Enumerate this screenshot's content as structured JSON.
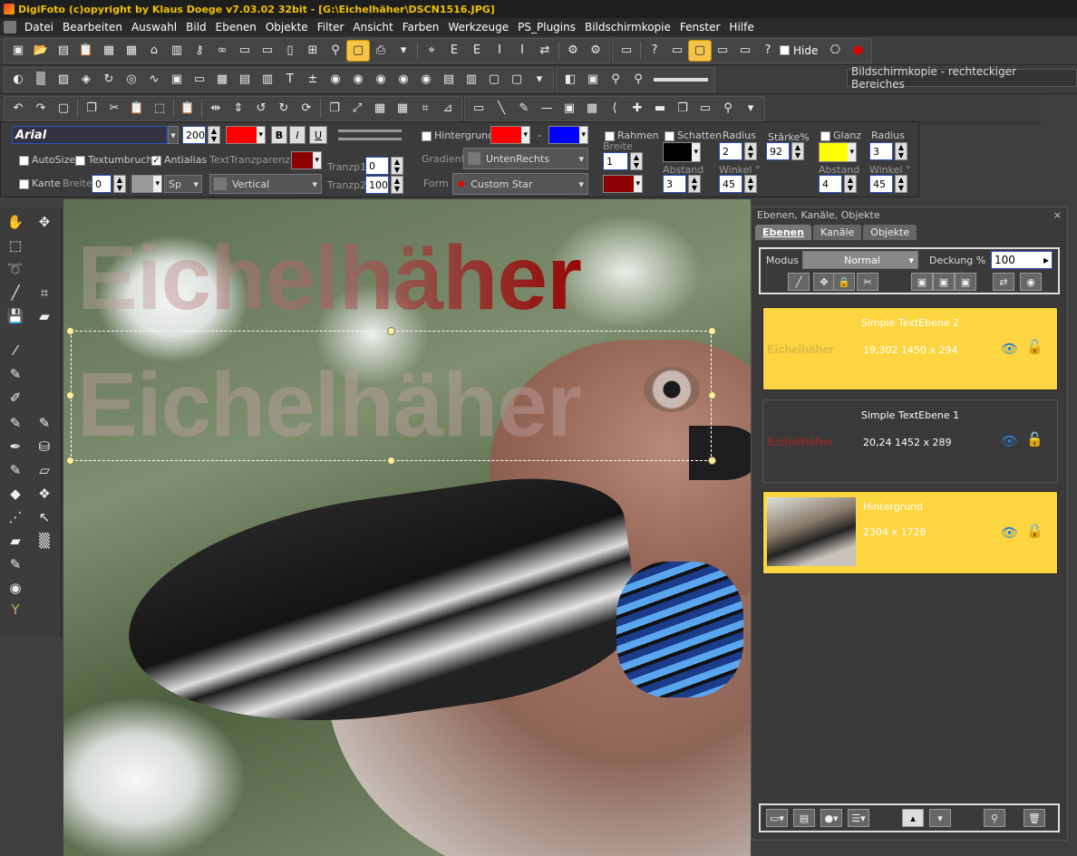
{
  "window": {
    "title": "DigiFoto (c)opyright by Klaus Doege v7.03.02 32bit - [G:\\Eichelhäher\\DSCN1516.JPG]"
  },
  "menu": [
    "Datei",
    "Bearbeiten",
    "Auswahl",
    "Bild",
    "Ebenen",
    "Objekte",
    "Filter",
    "Ansicht",
    "Farben",
    "Werkzeuge",
    "PS_Plugins",
    "Bildschirmkopie",
    "Fenster",
    "Hilfe"
  ],
  "toolbar": {
    "hide_label": "Hide",
    "tooltip": "Bildschirmkopie - rechteckiger Bereiches"
  },
  "textbar": {
    "font": "Arial",
    "size": "200",
    "bold": "B",
    "italic": "I",
    "underline": "U",
    "text_color": "#ff0000",
    "autosize": "AutoSize",
    "textumbruch": "Textumbruch",
    "antialias": "Antialias",
    "texttransparenz": "TextTranzparenz",
    "trans_color": "#8b0000",
    "kante": "Kante",
    "breite_label": "Breite",
    "breite_value": "0",
    "sp": "Sp",
    "vertical": "Vertical",
    "tranzp1_label": "Tranzp1",
    "tranzp1_value": "0",
    "tranzp2_label": "Tranzp2",
    "tranzp2_value": "100",
    "hintergrund": "Hintergrund",
    "hg_color1": "#ff0000",
    "hg_dash": "-",
    "hg_color2": "#0000ff",
    "gradient_label": "Gradient",
    "gradient_value": "UntenRechts",
    "form_label": "Form",
    "form_value": "Custom Star",
    "rahmen": "Rahmen",
    "rahmen_breite_label": "Breite",
    "rahmen_breite_value": "1",
    "rahmen_color": "#8b0000",
    "schatten": "Schatten",
    "schatten_color": "#000000",
    "radius_label": "Radius",
    "radius_value": "2",
    "staerke_label": "Stärke%",
    "staerke_value": "92",
    "abstand_label": "Abstand",
    "abstand_value": "3",
    "winkel_label": "Winkel °",
    "winkel_value": "45",
    "glanz": "Glanz",
    "glanz_color": "#ffff00",
    "glanz_radius_label": "Radius",
    "glanz_radius_value": "3",
    "glanz_abstand_label": "Abstand",
    "glanz_abstand_value": "4",
    "glanz_winkel_label": "Winkel °",
    "glanz_winkel_value": "45"
  },
  "canvas": {
    "text1": "Eichelhäher",
    "text2": "Eichelhäher"
  },
  "panel": {
    "title": "Ebenen, Kanäle, Objekte",
    "close": "×",
    "tabs": [
      "Ebenen",
      "Kanäle",
      "Objekte"
    ],
    "modus_label": "Modus",
    "modus_value": "Normal",
    "deckung_label": "Deckung %",
    "deckung_value": "100",
    "layers": [
      {
        "name": "Simple TextEbene 2",
        "info": "19,302  1450 x 294",
        "thumb": "Eichelhäher"
      },
      {
        "name": "Simple TextEbene 1",
        "info": "20,24  1452 x 289",
        "thumb": "Eichelhäher"
      },
      {
        "name": "Hintergrund",
        "info": "2304 x 1728",
        "thumb": ""
      }
    ]
  }
}
